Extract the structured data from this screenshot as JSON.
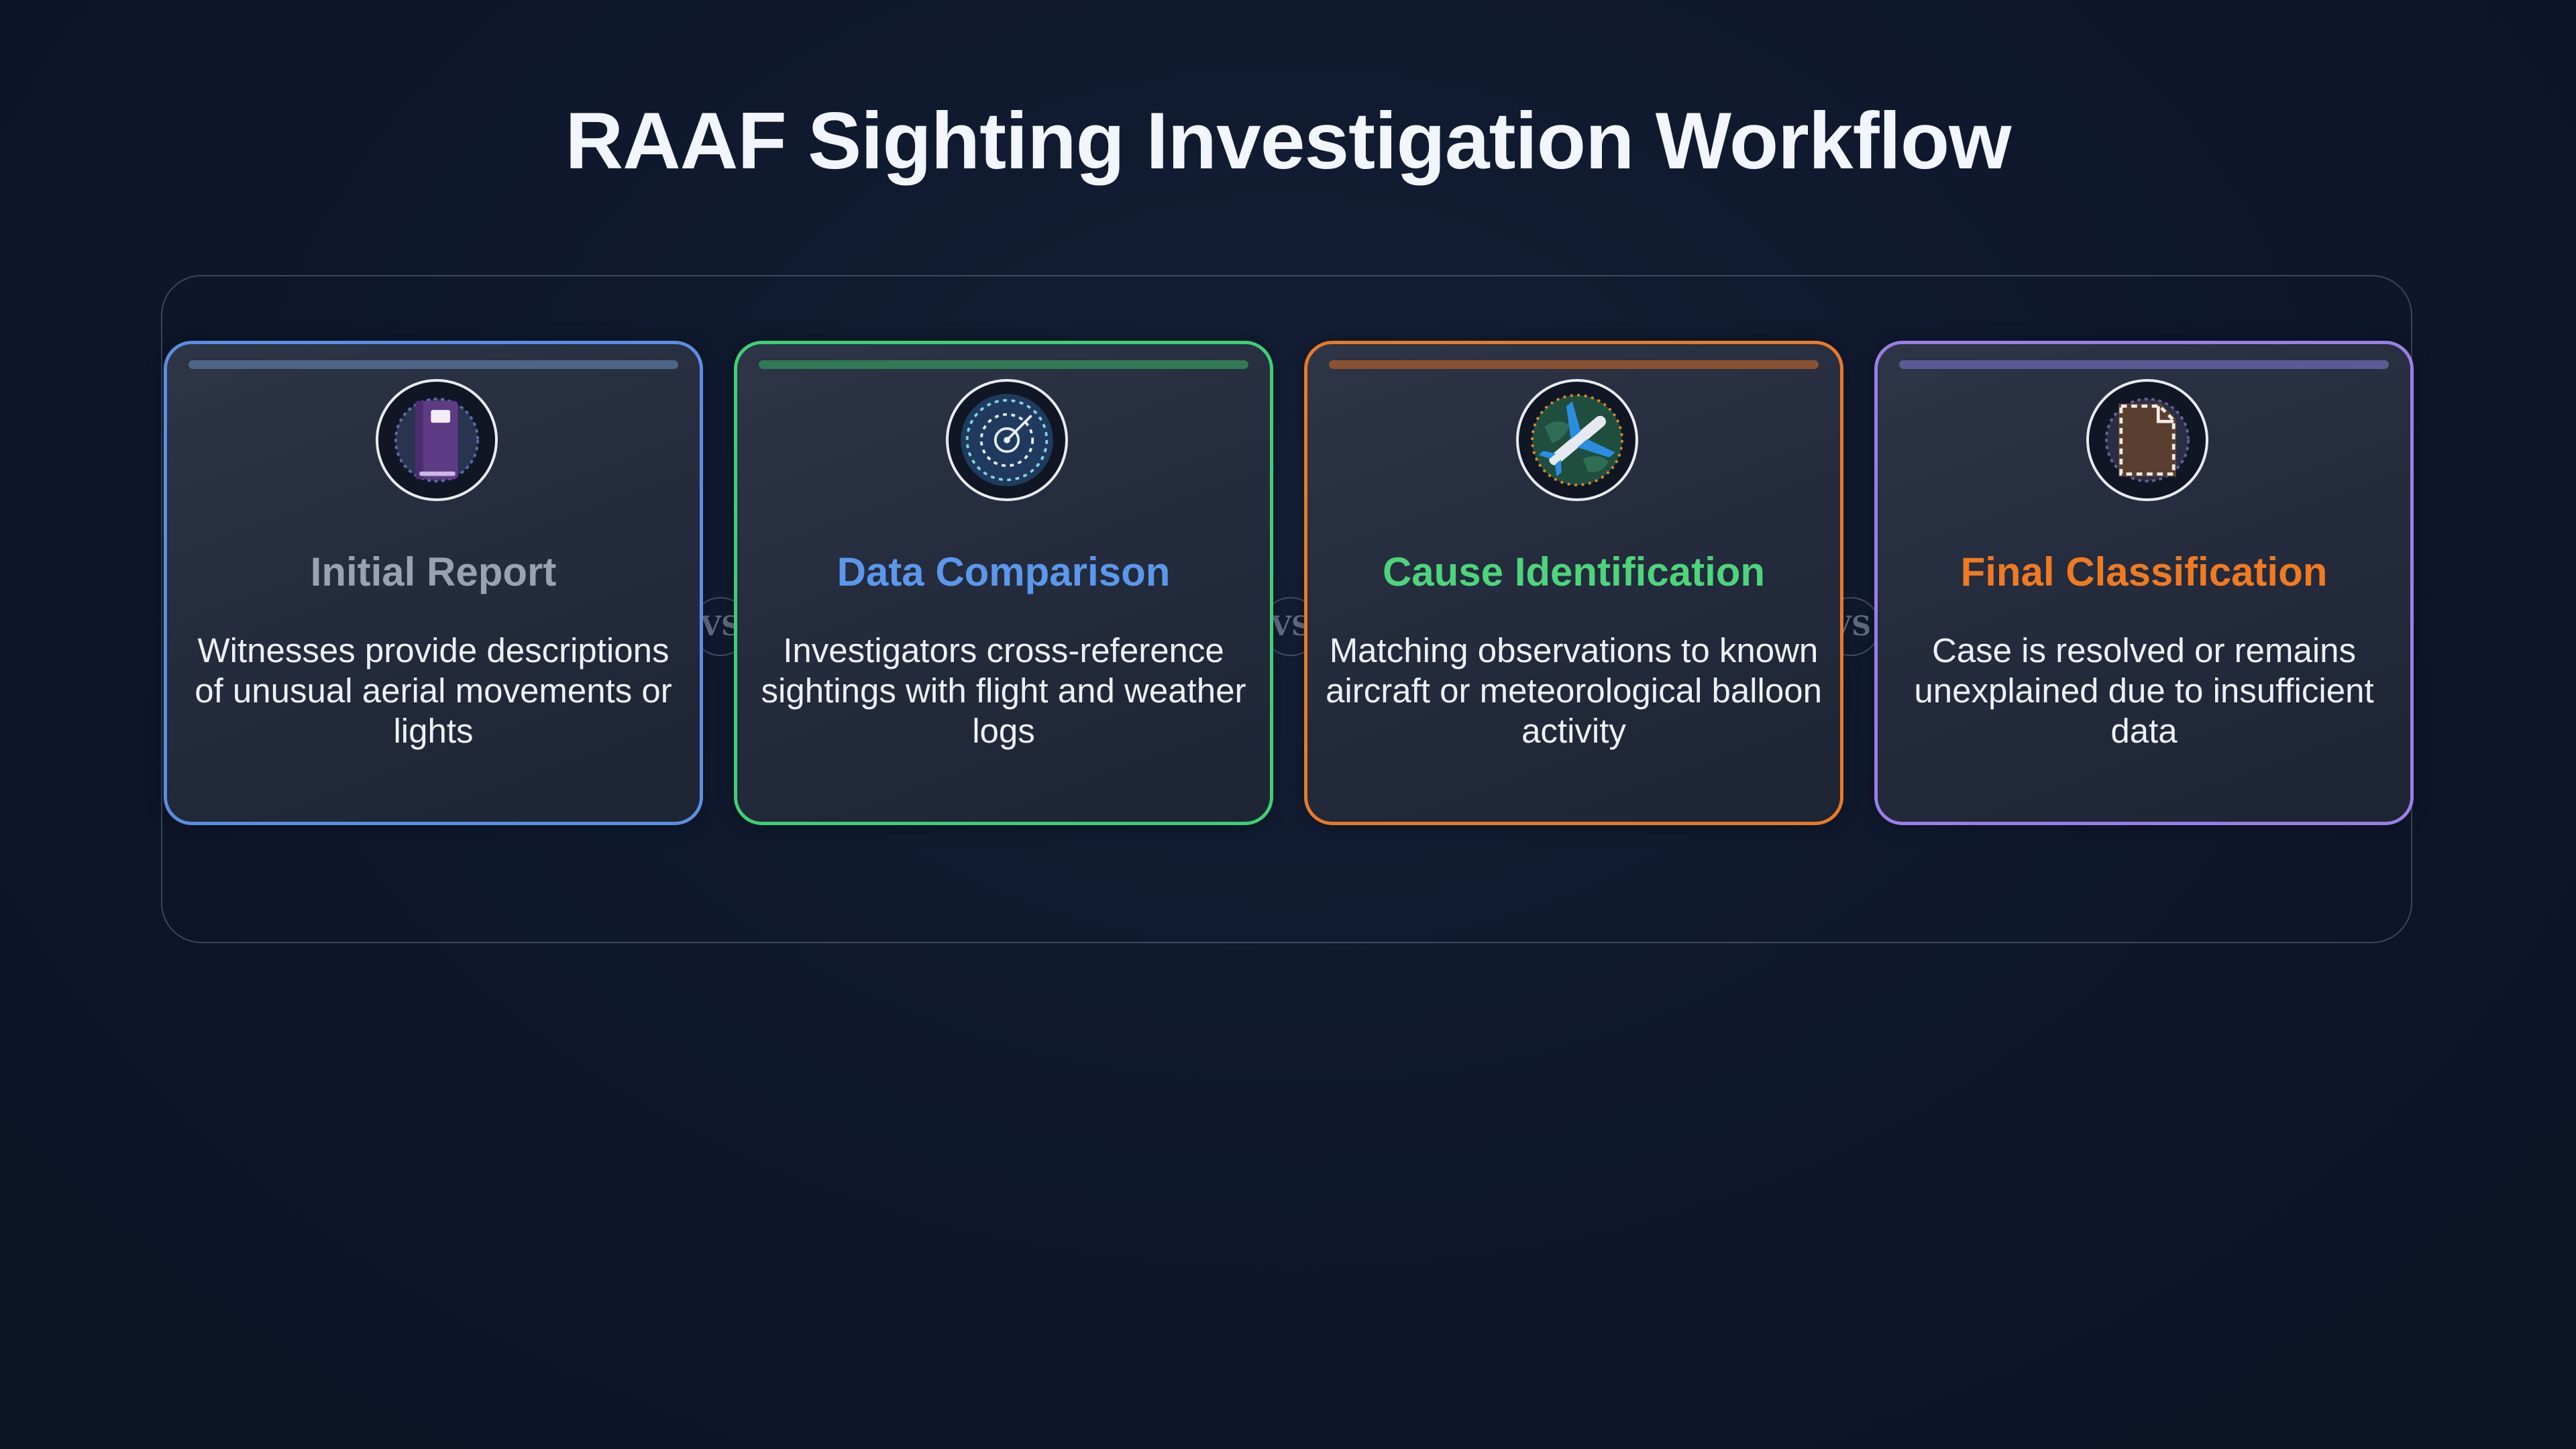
{
  "title": "RAAF Sighting Investigation Workflow",
  "connector_label": "VS",
  "steps": [
    {
      "title": "Initial Report",
      "description": "Witnesses provide descriptions of unusual aerial movements or lights",
      "icon": "notebook-icon",
      "border_color": "#5b8ee0",
      "bar_color": "#4d6688",
      "title_color": "#99a2b2"
    },
    {
      "title": "Data Comparison",
      "description": "Investigators cross-reference sightings with flight and weather logs",
      "icon": "radar-icon",
      "border_color": "#3ecf76",
      "bar_color": "#2f7a54",
      "title_color": "#5b97ea"
    },
    {
      "title": "Cause Identification",
      "description": "Matching observations to known aircraft or meteorological balloon activity",
      "icon": "airplane-globe-icon",
      "border_color": "#e77a2a",
      "bar_color": "#8a5230",
      "title_color": "#4ed47c"
    },
    {
      "title": "Final Classification",
      "description": "Case is resolved or remains unexplained due to insufficient data",
      "icon": "document-icon",
      "border_color": "#9a7ee6",
      "bar_color": "#5c5a94",
      "title_color": "#f07a22"
    }
  ]
}
